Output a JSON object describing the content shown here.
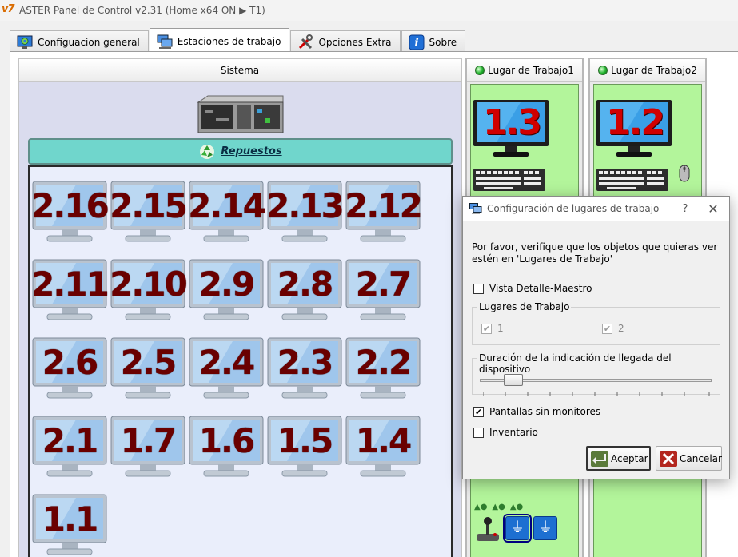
{
  "window": {
    "logo": "v7",
    "title": "ASTER Panel de Control v2.31 (Home x64 ON ▶ T1)"
  },
  "tabs": [
    {
      "label": "Configuacion general",
      "icon": "gear-monitor-icon"
    },
    {
      "label": "Estaciones de trabajo",
      "icon": "workstations-icon",
      "active": true
    },
    {
      "label": "Opciones Extra",
      "icon": "tools-icon"
    },
    {
      "label": "Sobre",
      "icon": "info-icon"
    }
  ],
  "system": {
    "title": "Sistema",
    "spares_label": "Repuestos",
    "monitors": [
      "2.16",
      "2.15",
      "2.14",
      "2.13",
      "2.12",
      "2.11",
      "2.10",
      "2.9",
      "2.8",
      "2.7",
      "2.6",
      "2.5",
      "2.4",
      "2.3",
      "2.2",
      "2.1",
      "1.7",
      "1.6",
      "1.5",
      "1.4",
      "1.1"
    ]
  },
  "workplaces": [
    {
      "title": "Lugar de Trabajo1",
      "monitor": "1.3"
    },
    {
      "title": "Lugar de Trabajo2",
      "monitor": "1.2"
    }
  ],
  "dialog": {
    "title": "Configuración de lugares de trabajo",
    "help": "?",
    "close": "✕",
    "message": "Por favor, verifique que los objetos que quieras ver estén en 'Lugares de Trabajo'",
    "vista_label": "Vista Detalle-Maestro",
    "group_workplaces": "Lugares de Trabajo",
    "wp1_label": "1",
    "wp2_label": "2",
    "group_duration": "Duración de la indicación de llegada del dispositivo",
    "pantallas_label": "Pantallas sin monitores",
    "inventario_label": "Inventario",
    "accept_label": "Aceptar",
    "cancel_label": "Cancelar",
    "check_mark": "✔"
  }
}
